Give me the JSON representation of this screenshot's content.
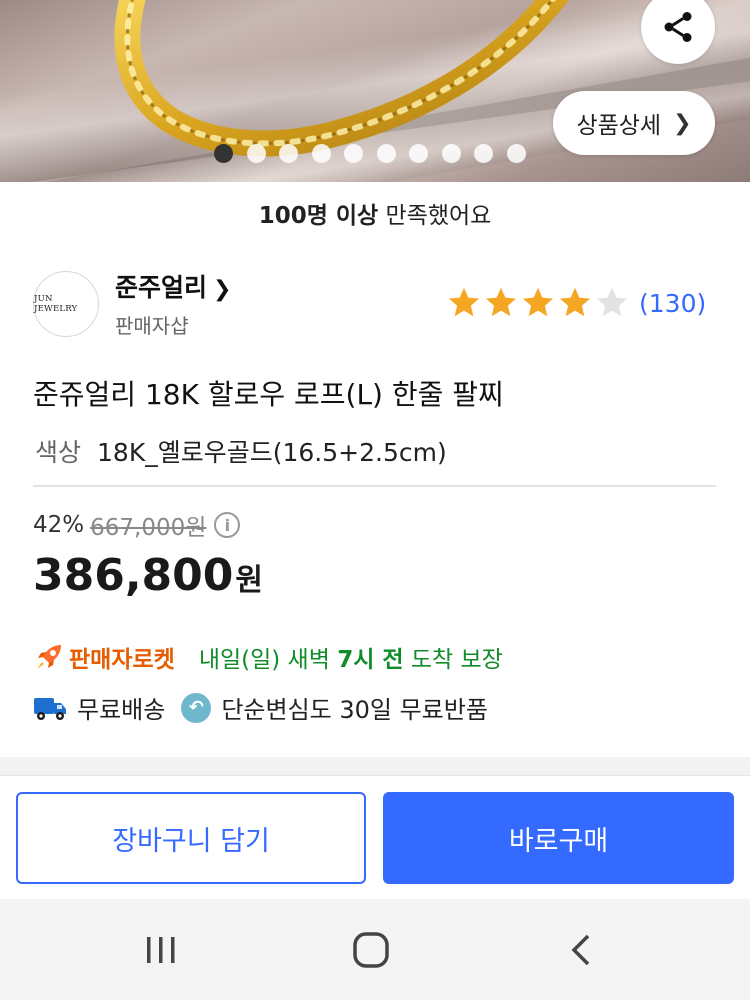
{
  "hero": {
    "image_desc": "gold-rope-bracelet-photo",
    "detail_button_label": "상품상세",
    "share_icon": "share-icon",
    "total_slides": 10,
    "active_slide": 1
  },
  "satisfaction": {
    "strong": "100명 이상",
    "rest": " 만족했어요"
  },
  "seller": {
    "logo_text": "JUN JEWELRY",
    "name": "준주얼리",
    "type": "판매자샵"
  },
  "rating": {
    "stars": 4,
    "max_stars": 5,
    "count": "(130)",
    "star_color": "#f5a623"
  },
  "product": {
    "title": "준쥬얼리 18K 할로우 로프(L) 한줄 팔찌",
    "option_label": "색상",
    "option_value": "18K_옐로우골드(16.5+2.5cm)"
  },
  "price": {
    "discount": "42%",
    "original": "667,000원",
    "sale_number": "386,800",
    "sale_unit": "원"
  },
  "delivery": {
    "rocket_brand": "판매자로켓",
    "arrival_prefix": "내일(일) 새벽 ",
    "arrival_bold": "7시 전",
    "arrival_suffix": " 도착 보장",
    "free_shipping": "무료배송",
    "free_return": "단순변심도 30일 무료반품"
  },
  "actions": {
    "cart": "장바구니 담기",
    "buy": "바로구매"
  },
  "colors": {
    "accent": "#346aff",
    "rocket": "#e85c00",
    "delivery_green": "#128b29"
  },
  "system_nav": {
    "recents": "recents-icon",
    "home": "home-icon",
    "back": "back-icon"
  }
}
